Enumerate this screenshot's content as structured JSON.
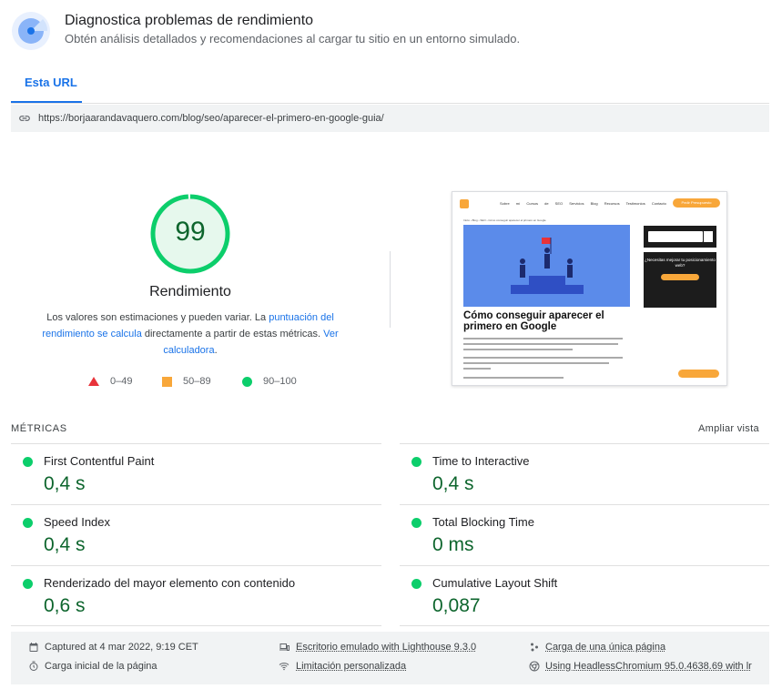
{
  "header": {
    "title": "Diagnostica problemas de rendimiento",
    "subtitle": "Obtén análisis detallados y recomendaciones al cargar tu sitio en un entorno simulado."
  },
  "tabs": [
    {
      "label": "Esta URL",
      "active": true
    }
  ],
  "url": "https://borjaarandavaquero.com/blog/seo/aparecer-el-primero-en-google-guia/",
  "score": {
    "value": "99",
    "fraction": 0.99,
    "label": "Rendimiento",
    "disclaimer_start": "Los valores son estimaciones y pueden variar. La ",
    "disclaimer_link1": "puntuación del rendimiento se calcula",
    "disclaimer_mid": " directamente a partir de estas métricas. ",
    "disclaimer_link2": "Ver calculadora",
    "disclaimer_end": "."
  },
  "legend": [
    {
      "range": "0–49",
      "shape": "triangle",
      "color": "#e8333a"
    },
    {
      "range": "50–89",
      "shape": "square",
      "color": "#f8a73a"
    },
    {
      "range": "90–100",
      "shape": "circle",
      "color": "#0cce6b"
    }
  ],
  "thumbnail": {
    "menu": "Sobre mí Cursos de SEO Servicios Blog Recursos Testimonios Contacto",
    "cta": "Pedir Presupuesto",
    "breadcrumb": "Inicio › Blog › SEO › Cómo conseguir aparecer el primero en Google",
    "heading": "Cómo conseguir aparecer el primero en Google",
    "promo": "¿Necesitas mejorar tu posicionamiento web?"
  },
  "metrics": {
    "title": "MÉTRICAS",
    "expand_label": "Ampliar vista",
    "items": [
      {
        "name": "First Contentful Paint",
        "value": "0,4 s"
      },
      {
        "name": "Time to Interactive",
        "value": "0,4 s"
      },
      {
        "name": "Speed Index",
        "value": "0,4 s"
      },
      {
        "name": "Total Blocking Time",
        "value": "0 ms"
      },
      {
        "name": "Renderizado del mayor elemento con contenido",
        "value": "0,6 s"
      },
      {
        "name": "Cumulative Layout Shift",
        "value": "0,087"
      }
    ],
    "good_color": "#0cce6b"
  },
  "footer": {
    "captured": "Captured at 4 mar 2022, 9:19 CET",
    "device": "Escritorio emulado with Lighthouse 9.3.0",
    "page_load": "Carga de una única página",
    "initial_load": "Carga inicial de la página",
    "throttling": "Limitación personalizada",
    "browser": "Using HeadlessChromium 95.0.4638.69 with lr"
  },
  "colors": {
    "accent": "#1a73e8",
    "pass": "#0cce6b",
    "pass_text": "#0d652d"
  }
}
